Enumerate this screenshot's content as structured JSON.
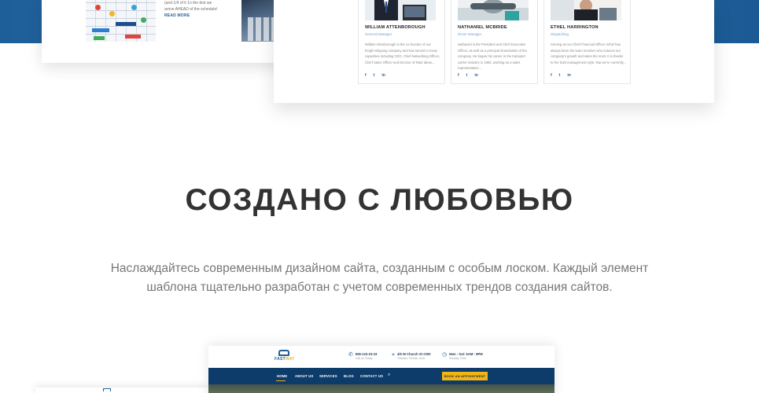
{
  "blog": {
    "text_lines": [
      "(and 1/4 of it 1o the tirst we",
      "arrive AHEAD of the schedule!"
    ],
    "read_more": "READ MORE"
  },
  "team": [
    {
      "name": "WILLIAM ATTENBOROUGH",
      "role": "General Manager",
      "bio": "William Attenborough is the co-founder of our freight shipping company and has served in many capacities including CEO, Chief Networking Officer, Chief Sales Officer and Director of R&D Ideas..."
    },
    {
      "name": "NATHANIEL MCBRIDE",
      "role": "Driver Manager",
      "bio": "Nathaniel is the President and Chief Executive Officer, as well as a principal shareholder of the company. He began his career in the transport carrier industry in 1992, working as a sales representative..."
    },
    {
      "name": "ETHEL HARRINGTON",
      "role": "Dispatching",
      "bio": "Serving as our Chief Financial Officer, Ethel has always been the team member who induces our company's growth and sales the most. It is thanks to her bold management style, that we're currently..."
    }
  ],
  "social": [
    "f",
    "t",
    "in"
  ],
  "section": {
    "title": "СОЗДАНО С ЛЮБОВЬЮ",
    "description": "Наслаждайтесь современным дизайном сайта, созданным с особым лоском. Каждый элемент шаблона тщательно разработан с учетом современных трендов создания сайтов."
  },
  "mockup": {
    "logo": {
      "part1": "FAST",
      "part2": "WAY"
    },
    "contacts": [
      {
        "icon": "phone-icon",
        "main": "555-123-23-23",
        "sub": "Call us Today"
      },
      {
        "icon": "pin-icon",
        "main": "4/5 W Church St #200",
        "sub": "Orlando, Florida, USA"
      },
      {
        "icon": "clock-icon",
        "main": "Mon - Sat: 6AM - 9PM",
        "sub": "Sunday: Rest"
      }
    ],
    "nav": [
      "HOME",
      "ABOUT US",
      "SERVICES",
      "BLOG",
      "CONTACT US"
    ],
    "cta": "BOOK AN APPOINTMENT"
  },
  "colors": {
    "brand_blue": "#1f5f99",
    "nav_navy": "#0d3b6a",
    "accent_yellow": "#f3b515",
    "heading": "#333333",
    "body_text": "#777777"
  }
}
